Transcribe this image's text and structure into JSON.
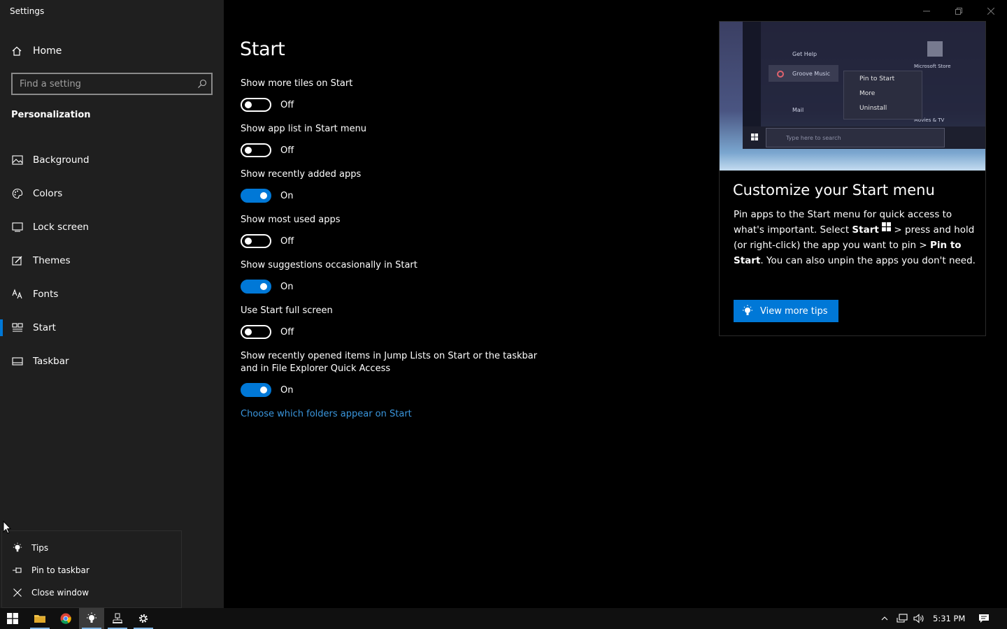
{
  "window": {
    "title": "Settings",
    "controls": [
      "minimize-icon",
      "restore-icon",
      "close-icon"
    ]
  },
  "sidebar": {
    "home_label": "Home",
    "search_placeholder": "Find a setting",
    "section_title": "Personalization",
    "items": [
      {
        "label": "Background",
        "icon": "picture-icon"
      },
      {
        "label": "Colors",
        "icon": "palette-icon"
      },
      {
        "label": "Lock screen",
        "icon": "lock-screen-icon"
      },
      {
        "label": "Themes",
        "icon": "brush-icon"
      },
      {
        "label": "Fonts",
        "icon": "font-icon"
      },
      {
        "label": "Start",
        "icon": "start-icon",
        "active": true
      },
      {
        "label": "Taskbar",
        "icon": "taskbar-icon"
      }
    ]
  },
  "main": {
    "title": "Start",
    "settings": [
      {
        "label": "Show more tiles on Start",
        "state": "Off",
        "on": false
      },
      {
        "label": "Show app list in Start menu",
        "state": "Off",
        "on": false
      },
      {
        "label": "Show recently added apps",
        "state": "On",
        "on": true
      },
      {
        "label": "Show most used apps",
        "state": "Off",
        "on": false
      },
      {
        "label": "Show suggestions occasionally in Start",
        "state": "On",
        "on": true
      },
      {
        "label": "Use Start full screen",
        "state": "Off",
        "on": false
      },
      {
        "label": "Show recently opened items in Jump Lists on Start or the taskbar and in File Explorer Quick Access",
        "state": "On",
        "on": true
      }
    ],
    "link": "Choose which folders appear on Start"
  },
  "tips": {
    "preview": {
      "menu_items": [
        "Pin to Start",
        "More",
        "Uninstall"
      ],
      "app_label": "Groove Music",
      "help_label": "Get Help",
      "mail_label": "Mail",
      "search_placeholder": "Type here to search",
      "store_label": "Microsoft Store",
      "movies_label": "Movies & TV"
    },
    "heading": "Customize your Start menu",
    "body_1": "Pin apps to the Start menu for quick access to what's important. Select ",
    "body_bold_1": "Start",
    "body_2": " > press and hold (or right-click) the app you want to pin > ",
    "body_bold_2": "Pin to Start",
    "body_3": ". You can also unpin the apps you don't need.",
    "button": "View more tips"
  },
  "jumplist": {
    "items": [
      {
        "label": "Tips",
        "icon": "lightbulb-icon"
      },
      {
        "label": "Pin to taskbar",
        "icon": "pin-icon"
      },
      {
        "label": "Close window",
        "icon": "close-icon"
      }
    ]
  },
  "taskbar": {
    "apps": [
      "windows-start-icon",
      "file-explorer-icon",
      "chrome-icon",
      "tips-icon",
      "network-app-icon",
      "settings-gear-icon"
    ],
    "clock": "5:31 PM"
  },
  "colors": {
    "accent": "#0078d7",
    "link": "#3a96dd",
    "sidebar_bg": "#1f1f1f",
    "content_bg": "#000000"
  }
}
